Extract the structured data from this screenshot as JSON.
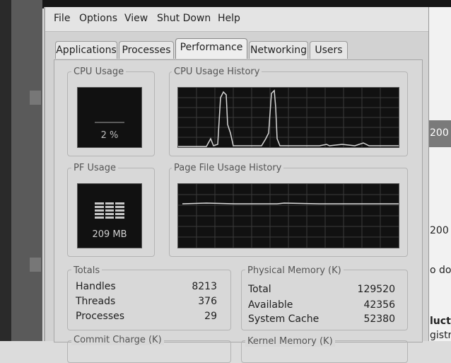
{
  "menu": [
    "File",
    "Options",
    "View",
    "Shut Down",
    "Help"
  ],
  "tabs": [
    "Applications",
    "Processes",
    "Performance",
    "Networking",
    "Users"
  ],
  "active_tab": "Performance",
  "cpu_usage": {
    "title": "CPU Usage",
    "value": "2 %"
  },
  "cpu_history": {
    "title": "CPU Usage History"
  },
  "pf_usage": {
    "title": "PF Usage",
    "value": "209 MB"
  },
  "pf_history": {
    "title": "Page File Usage History"
  },
  "totals": {
    "title": "Totals",
    "rows": [
      {
        "label": "Handles",
        "value": "8213"
      },
      {
        "label": "Threads",
        "value": "376"
      },
      {
        "label": "Processes",
        "value": "29"
      }
    ]
  },
  "physical_memory": {
    "title": "Physical Memory (K)",
    "rows": [
      {
        "label": "Total",
        "value": "129520"
      },
      {
        "label": "Available",
        "value": "42356"
      },
      {
        "label": "System Cache",
        "value": "52380"
      }
    ]
  },
  "commit_charge": {
    "title": "Commit Charge (K)"
  },
  "kernel_memory": {
    "title": "Kernel Memory (K)"
  },
  "background_page": {
    "fragments": [
      "200",
      "200",
      "o dow",
      "luct",
      "gistra"
    ]
  }
}
